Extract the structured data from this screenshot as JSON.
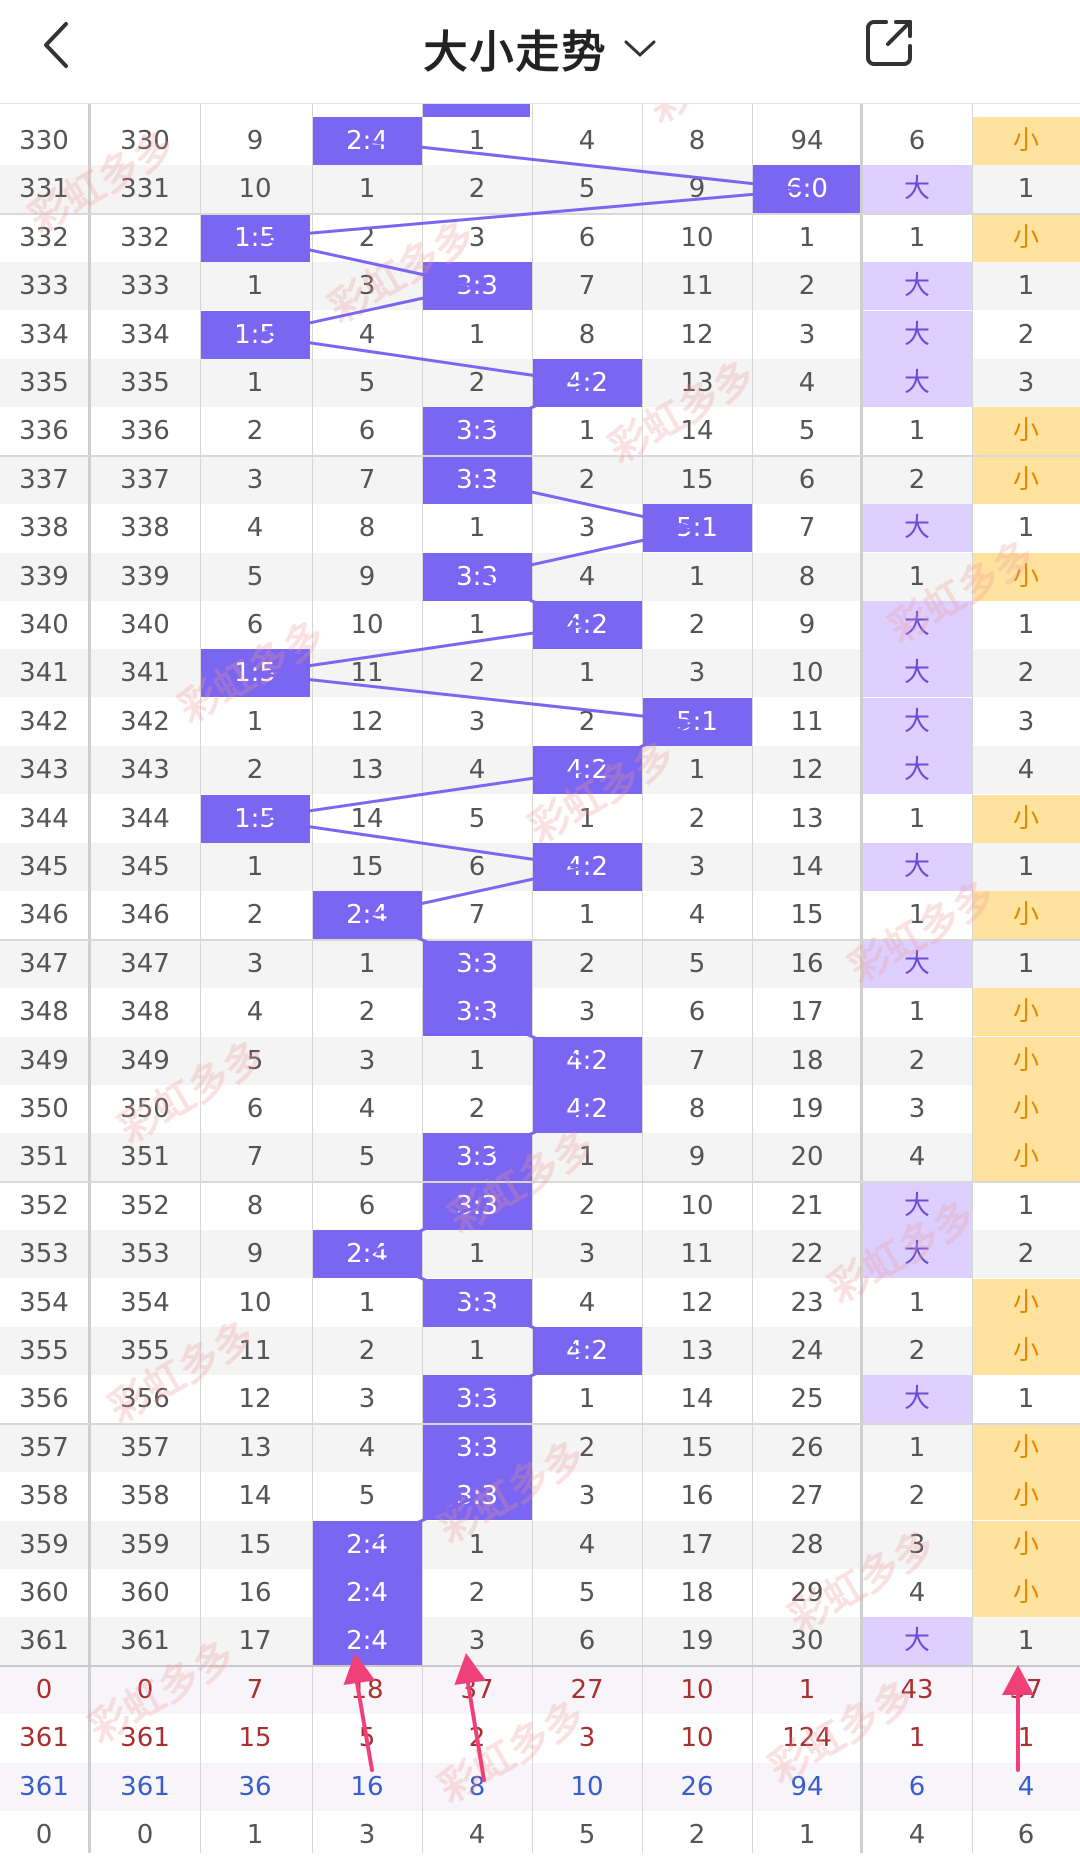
{
  "header": {
    "title": "大小走势"
  },
  "icons": {
    "back": "chevron-left-icon",
    "dropdown": "chevron-down-icon",
    "share": "share-external-icon"
  },
  "colors": {
    "highlight": "#7a66f0",
    "big_bg": "#ddd0ff",
    "small_bg": "#ffe29e",
    "stat_red": "#a83030",
    "stat_blue": "#3a5ec8",
    "arrow": "#f0407a"
  },
  "partial_top_row": {
    "c0": "",
    "c1": ""
  },
  "rows": [
    {
      "issue": "330",
      "cells": [
        "330",
        "9",
        "2:4",
        "1",
        "4",
        "8",
        "94",
        "6",
        "小"
      ],
      "hl": 2,
      "big": false,
      "small": true
    },
    {
      "issue": "331",
      "cells": [
        "331",
        "10",
        "1",
        "2",
        "5",
        "9",
        "6:0",
        "大",
        "1"
      ],
      "hl": 6,
      "big": true,
      "small": false
    },
    {
      "issue": "332",
      "cells": [
        "332",
        "1:5",
        "2",
        "3",
        "6",
        "10",
        "1",
        "1",
        "小"
      ],
      "hl": 1,
      "big": false,
      "small": true
    },
    {
      "issue": "333",
      "cells": [
        "333",
        "1",
        "3",
        "3:3",
        "7",
        "11",
        "2",
        "大",
        "1"
      ],
      "hl": 3,
      "big": true,
      "small": false
    },
    {
      "issue": "334",
      "cells": [
        "334",
        "1:5",
        "4",
        "1",
        "8",
        "12",
        "3",
        "大",
        "2"
      ],
      "hl": 1,
      "big": true,
      "small": false
    },
    {
      "issue": "335",
      "cells": [
        "335",
        "1",
        "5",
        "2",
        "4:2",
        "13",
        "4",
        "大",
        "3"
      ],
      "hl": 4,
      "big": true,
      "small": false
    },
    {
      "issue": "336",
      "cells": [
        "336",
        "2",
        "6",
        "3:3",
        "1",
        "14",
        "5",
        "1",
        "小"
      ],
      "hl": 3,
      "big": false,
      "small": true
    },
    {
      "issue": "337",
      "cells": [
        "337",
        "3",
        "7",
        "3:3",
        "2",
        "15",
        "6",
        "2",
        "小"
      ],
      "hl": 3,
      "big": false,
      "small": true
    },
    {
      "issue": "338",
      "cells": [
        "338",
        "4",
        "8",
        "1",
        "3",
        "5:1",
        "7",
        "大",
        "1"
      ],
      "hl": 5,
      "big": true,
      "small": false
    },
    {
      "issue": "339",
      "cells": [
        "339",
        "5",
        "9",
        "3:3",
        "4",
        "1",
        "8",
        "1",
        "小"
      ],
      "hl": 3,
      "big": false,
      "small": true
    },
    {
      "issue": "340",
      "cells": [
        "340",
        "6",
        "10",
        "1",
        "4:2",
        "2",
        "9",
        "大",
        "1"
      ],
      "hl": 4,
      "big": true,
      "small": false
    },
    {
      "issue": "341",
      "cells": [
        "341",
        "1:5",
        "11",
        "2",
        "1",
        "3",
        "10",
        "大",
        "2"
      ],
      "hl": 1,
      "big": true,
      "small": false
    },
    {
      "issue": "342",
      "cells": [
        "342",
        "1",
        "12",
        "3",
        "2",
        "5:1",
        "11",
        "大",
        "3"
      ],
      "hl": 5,
      "big": true,
      "small": false
    },
    {
      "issue": "343",
      "cells": [
        "343",
        "2",
        "13",
        "4",
        "4:2",
        "1",
        "12",
        "大",
        "4"
      ],
      "hl": 4,
      "big": true,
      "small": false
    },
    {
      "issue": "344",
      "cells": [
        "344",
        "1:5",
        "14",
        "5",
        "1",
        "2",
        "13",
        "1",
        "小"
      ],
      "hl": 1,
      "big": false,
      "small": true
    },
    {
      "issue": "345",
      "cells": [
        "345",
        "1",
        "15",
        "6",
        "4:2",
        "3",
        "14",
        "大",
        "1"
      ],
      "hl": 4,
      "big": true,
      "small": false
    },
    {
      "issue": "346",
      "cells": [
        "346",
        "2",
        "2:4",
        "7",
        "1",
        "4",
        "15",
        "1",
        "小"
      ],
      "hl": 2,
      "big": false,
      "small": true
    },
    {
      "issue": "347",
      "cells": [
        "347",
        "3",
        "1",
        "3:3",
        "2",
        "5",
        "16",
        "大",
        "1"
      ],
      "hl": 3,
      "big": true,
      "small": false
    },
    {
      "issue": "348",
      "cells": [
        "348",
        "4",
        "2",
        "3:3",
        "3",
        "6",
        "17",
        "1",
        "小"
      ],
      "hl": 3,
      "big": false,
      "small": true
    },
    {
      "issue": "349",
      "cells": [
        "349",
        "5",
        "3",
        "1",
        "4:2",
        "7",
        "18",
        "2",
        "小"
      ],
      "hl": 4,
      "big": false,
      "small": true
    },
    {
      "issue": "350",
      "cells": [
        "350",
        "6",
        "4",
        "2",
        "4:2",
        "8",
        "19",
        "3",
        "小"
      ],
      "hl": 4,
      "big": false,
      "small": true
    },
    {
      "issue": "351",
      "cells": [
        "351",
        "7",
        "5",
        "3:3",
        "1",
        "9",
        "20",
        "4",
        "小"
      ],
      "hl": 3,
      "big": false,
      "small": true
    },
    {
      "issue": "352",
      "cells": [
        "352",
        "8",
        "6",
        "3:3",
        "2",
        "10",
        "21",
        "大",
        "1"
      ],
      "hl": 3,
      "big": true,
      "small": false
    },
    {
      "issue": "353",
      "cells": [
        "353",
        "9",
        "2:4",
        "1",
        "3",
        "11",
        "22",
        "大",
        "2"
      ],
      "hl": 2,
      "big": true,
      "small": false
    },
    {
      "issue": "354",
      "cells": [
        "354",
        "10",
        "1",
        "3:3",
        "4",
        "12",
        "23",
        "1",
        "小"
      ],
      "hl": 3,
      "big": false,
      "small": true
    },
    {
      "issue": "355",
      "cells": [
        "355",
        "11",
        "2",
        "1",
        "4:2",
        "13",
        "24",
        "2",
        "小"
      ],
      "hl": 4,
      "big": false,
      "small": true
    },
    {
      "issue": "356",
      "cells": [
        "356",
        "12",
        "3",
        "3:3",
        "1",
        "14",
        "25",
        "大",
        "1"
      ],
      "hl": 3,
      "big": true,
      "small": false
    },
    {
      "issue": "357",
      "cells": [
        "357",
        "13",
        "4",
        "3:3",
        "2",
        "15",
        "26",
        "1",
        "小"
      ],
      "hl": 3,
      "big": false,
      "small": true
    },
    {
      "issue": "358",
      "cells": [
        "358",
        "14",
        "5",
        "3:3",
        "3",
        "16",
        "27",
        "2",
        "小"
      ],
      "hl": 3,
      "big": false,
      "small": true
    },
    {
      "issue": "359",
      "cells": [
        "359",
        "15",
        "2:4",
        "1",
        "4",
        "17",
        "28",
        "3",
        "小"
      ],
      "hl": 2,
      "big": false,
      "small": true
    },
    {
      "issue": "360",
      "cells": [
        "360",
        "16",
        "2:4",
        "2",
        "5",
        "18",
        "29",
        "4",
        "小"
      ],
      "hl": 2,
      "big": false,
      "small": true
    },
    {
      "issue": "361",
      "cells": [
        "361",
        "17",
        "2:4",
        "3",
        "6",
        "19",
        "30",
        "大",
        "1"
      ],
      "hl": 2,
      "big": true,
      "small": false
    }
  ],
  "stats": [
    {
      "style": "red",
      "cells": [
        "0",
        "0",
        "7",
        "18",
        "37",
        "27",
        "10",
        "1",
        "43",
        "37"
      ]
    },
    {
      "style": "red",
      "cells": [
        "361",
        "361",
        "15",
        "5",
        "2",
        "3",
        "10",
        "124",
        "1",
        "1"
      ]
    },
    {
      "style": "blue",
      "cells": [
        "361",
        "361",
        "36",
        "16",
        "8",
        "10",
        "26",
        "94",
        "6",
        "4"
      ]
    },
    {
      "style": "gray",
      "cells": [
        "0",
        "0",
        "1",
        "3",
        "4",
        "5",
        "2",
        "1",
        "4",
        "6"
      ]
    }
  ],
  "watermark": "彩虹多多"
}
